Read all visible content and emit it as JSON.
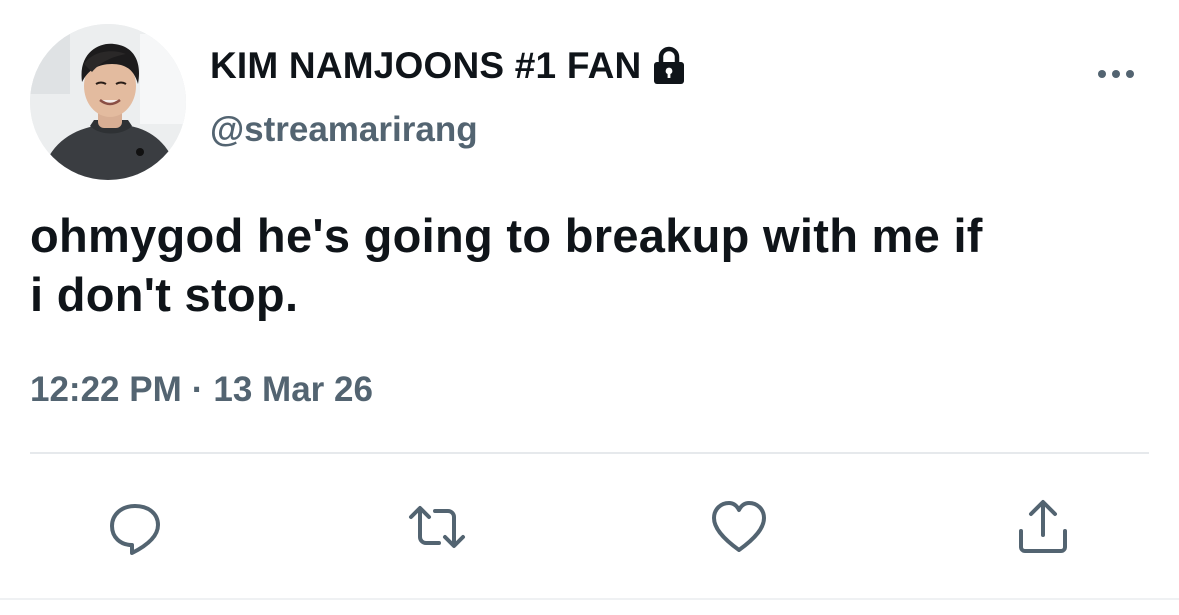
{
  "tweet": {
    "display_name": "KIM NAMJOONS #1 FAN",
    "handle": "@streamarirang",
    "protected_icon": "lock-icon",
    "more_icon": "more-horizontal-icon",
    "text_line1": "ohmygod he's going to breakup with me if",
    "text_line2": "i don't stop.",
    "time": "12:22 PM",
    "separator": "·",
    "date": "13 Mar 26"
  },
  "actions": {
    "reply_icon": "reply-icon",
    "retweet_icon": "retweet-icon",
    "like_icon": "heart-icon",
    "share_icon": "share-icon"
  },
  "colors": {
    "text_primary": "#0f1419",
    "text_secondary": "#536471",
    "divider": "#e6e9ec",
    "background": "#ffffff"
  }
}
